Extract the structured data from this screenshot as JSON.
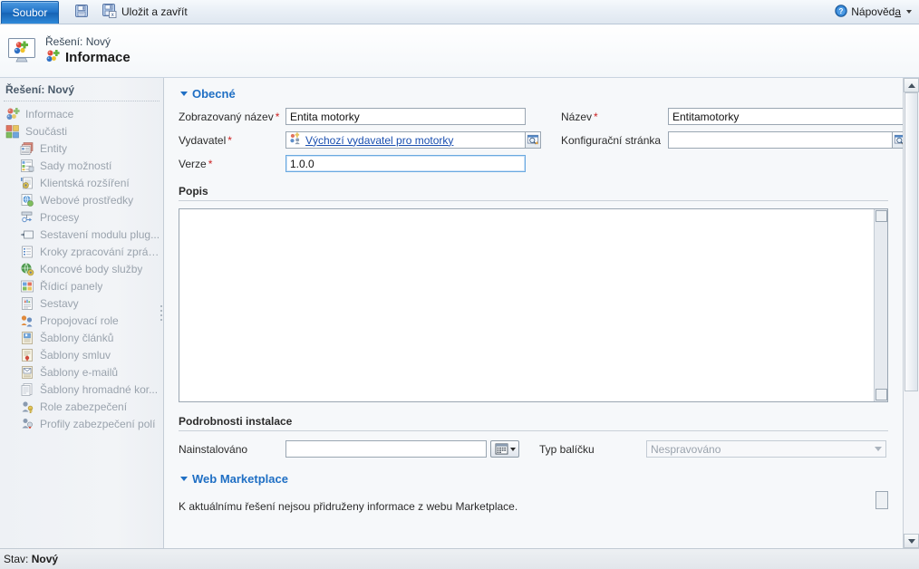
{
  "ribbon": {
    "file_tab": "Soubor",
    "save_icon": "save-icon",
    "save_close_label": "Uložit a zavřít",
    "save_close_icon": "save-and-close-icon",
    "help_label_pre": "Nápověd",
    "help_label_underlined": "a",
    "help_icon": "help-question-icon"
  },
  "record_header": {
    "icon": "solution-icon",
    "subtitle": "Řešení: Nový",
    "title_icon": "solution-small-icon",
    "title": "Informace"
  },
  "sidebar": {
    "title": "Řešení: Nový",
    "items": [
      {
        "label": "Informace",
        "icon": "solution-info-icon",
        "level": 1
      },
      {
        "label": "Součásti",
        "icon": "components-icon",
        "level": 1
      },
      {
        "label": "Entity",
        "icon": "entity-icon",
        "level": 2
      },
      {
        "label": "Sady možností",
        "icon": "option-sets-icon",
        "level": 2
      },
      {
        "label": "Klientská rozšíření",
        "icon": "client-extensions-icon",
        "level": 2
      },
      {
        "label": "Webové prostředky",
        "icon": "web-resources-icon",
        "level": 2
      },
      {
        "label": "Procesy",
        "icon": "processes-icon",
        "level": 2
      },
      {
        "label": "Sestavení modulu plug...",
        "icon": "plugin-assembly-icon",
        "level": 2
      },
      {
        "label": "Kroky zpracování zprávy...",
        "icon": "sdk-message-steps-icon",
        "level": 2
      },
      {
        "label": "Koncové body služby",
        "icon": "service-endpoints-icon",
        "level": 2
      },
      {
        "label": "Řídicí panely",
        "icon": "dashboards-icon",
        "level": 2
      },
      {
        "label": "Sestavy",
        "icon": "reports-icon",
        "level": 2
      },
      {
        "label": "Propojovací role",
        "icon": "connection-roles-icon",
        "level": 2
      },
      {
        "label": "Šablony článků",
        "icon": "article-templates-icon",
        "level": 2
      },
      {
        "label": "Šablony smluv",
        "icon": "contract-templates-icon",
        "level": 2
      },
      {
        "label": "Šablony e-mailů",
        "icon": "email-templates-icon",
        "level": 2
      },
      {
        "label": "Šablony hromadné kor...",
        "icon": "mail-merge-templates-icon",
        "level": 2
      },
      {
        "label": "Role zabezpečení",
        "icon": "security-roles-icon",
        "level": 2
      },
      {
        "label": "Profily zabezpečení polí",
        "icon": "field-security-profiles-icon",
        "level": 2
      }
    ]
  },
  "form": {
    "general_section": {
      "title": "Obecné",
      "display_name_label": "Zobrazovaný název",
      "display_name_value": "Entita motorky",
      "publisher_label": "Vydavatel",
      "publisher_value": "Výchozí vydavatel pro motorky",
      "publisher_icon": "publisher-icon",
      "publisher_lookup_icon": "lookup-icon",
      "version_label": "Verze",
      "version_value": "1.0.0",
      "name_label": "Název",
      "name_value": "Entitamotorky",
      "config_page_label": "Konfigurační stránka",
      "config_page_value": "",
      "config_page_lookup_icon": "lookup-icon",
      "required_mark": "*"
    },
    "description": {
      "heading": "Popis",
      "value": ""
    },
    "install_details": {
      "heading": "Podrobnosti instalace",
      "installed_label": "Nainstalováno",
      "installed_value": "",
      "calendar_icon": "calendar-icon",
      "package_type_label": "Typ balíčku",
      "package_type_value": "Nespravováno"
    },
    "marketplace": {
      "title": "Web Marketplace",
      "message": "K aktuálnímu řešení nejsou přidruženy informace z webu Marketplace."
    }
  },
  "status_bar": {
    "prefix": "Stav:",
    "value": "Nový"
  },
  "colors": {
    "accent_blue": "#1f6fc4",
    "link_blue": "#1a4fb0",
    "required_red": "#cc2222",
    "sidebar_text": "#9aa3ad"
  }
}
